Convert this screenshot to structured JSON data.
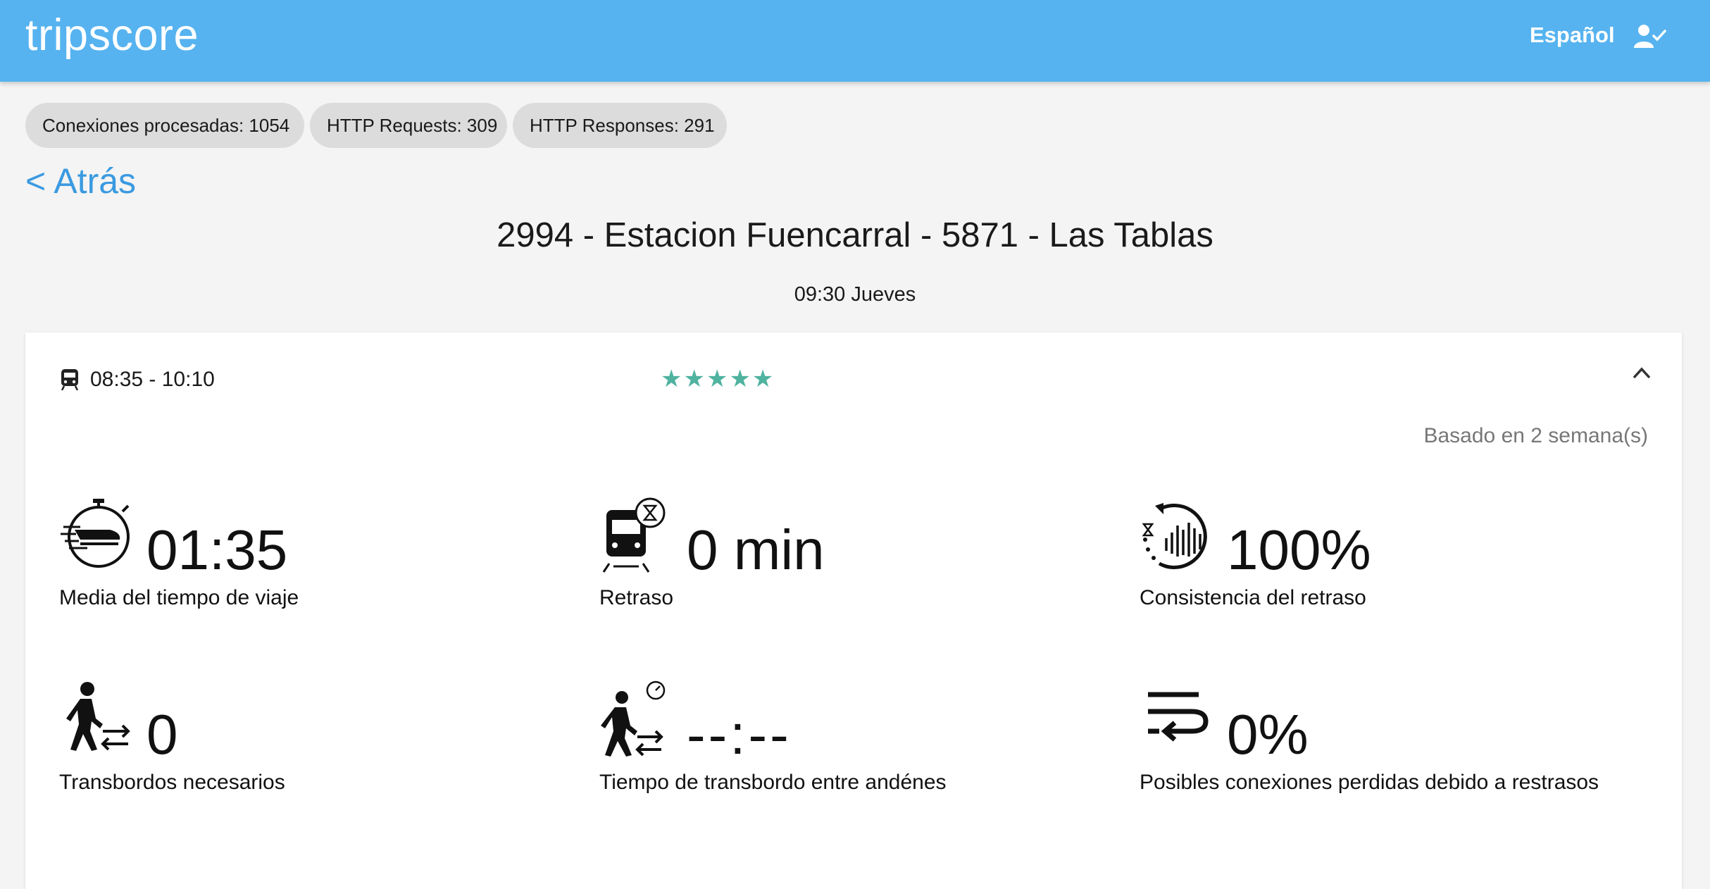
{
  "app": {
    "brand": "tripscore",
    "language": "Español"
  },
  "stats": [
    {
      "label": "Conexiones procesadas: 1054"
    },
    {
      "label": "HTTP Requests: 309"
    },
    {
      "label": "HTTP Responses: 291"
    }
  ],
  "nav": {
    "back_label": "< Atrás"
  },
  "route": {
    "title": "2994 - Estacion Fuencarral - 5871 - Las Tablas",
    "time_day": "09:30 Jueves"
  },
  "trip": {
    "time_range": "08:35 - 10:10",
    "stars": "★★★★★",
    "rating": 5,
    "based_on": "Basado en 2 semana(s)"
  },
  "metrics": [
    {
      "icon": "travel-time-icon",
      "value": "01:35",
      "label": "Media del tiempo de viaje"
    },
    {
      "icon": "train-delay-icon",
      "value": "0 min",
      "label": "Retraso"
    },
    {
      "icon": "delay-consistency-icon",
      "value": "100%",
      "label": "Consistencia del retraso"
    },
    {
      "icon": "walking-transfer-icon",
      "value": "0",
      "label": "Transbordos necesarios"
    },
    {
      "icon": "transfer-time-icon",
      "value": "--:--",
      "label": "Tiempo de transbordo entre andénes"
    },
    {
      "icon": "missed-connection-icon",
      "value": "0%",
      "label": "Posibles conexiones perdidas debido a restrasos"
    }
  ],
  "colors": {
    "header": "#56b3f0",
    "link": "#3a9ae0",
    "stars": "#4fb3a0"
  }
}
